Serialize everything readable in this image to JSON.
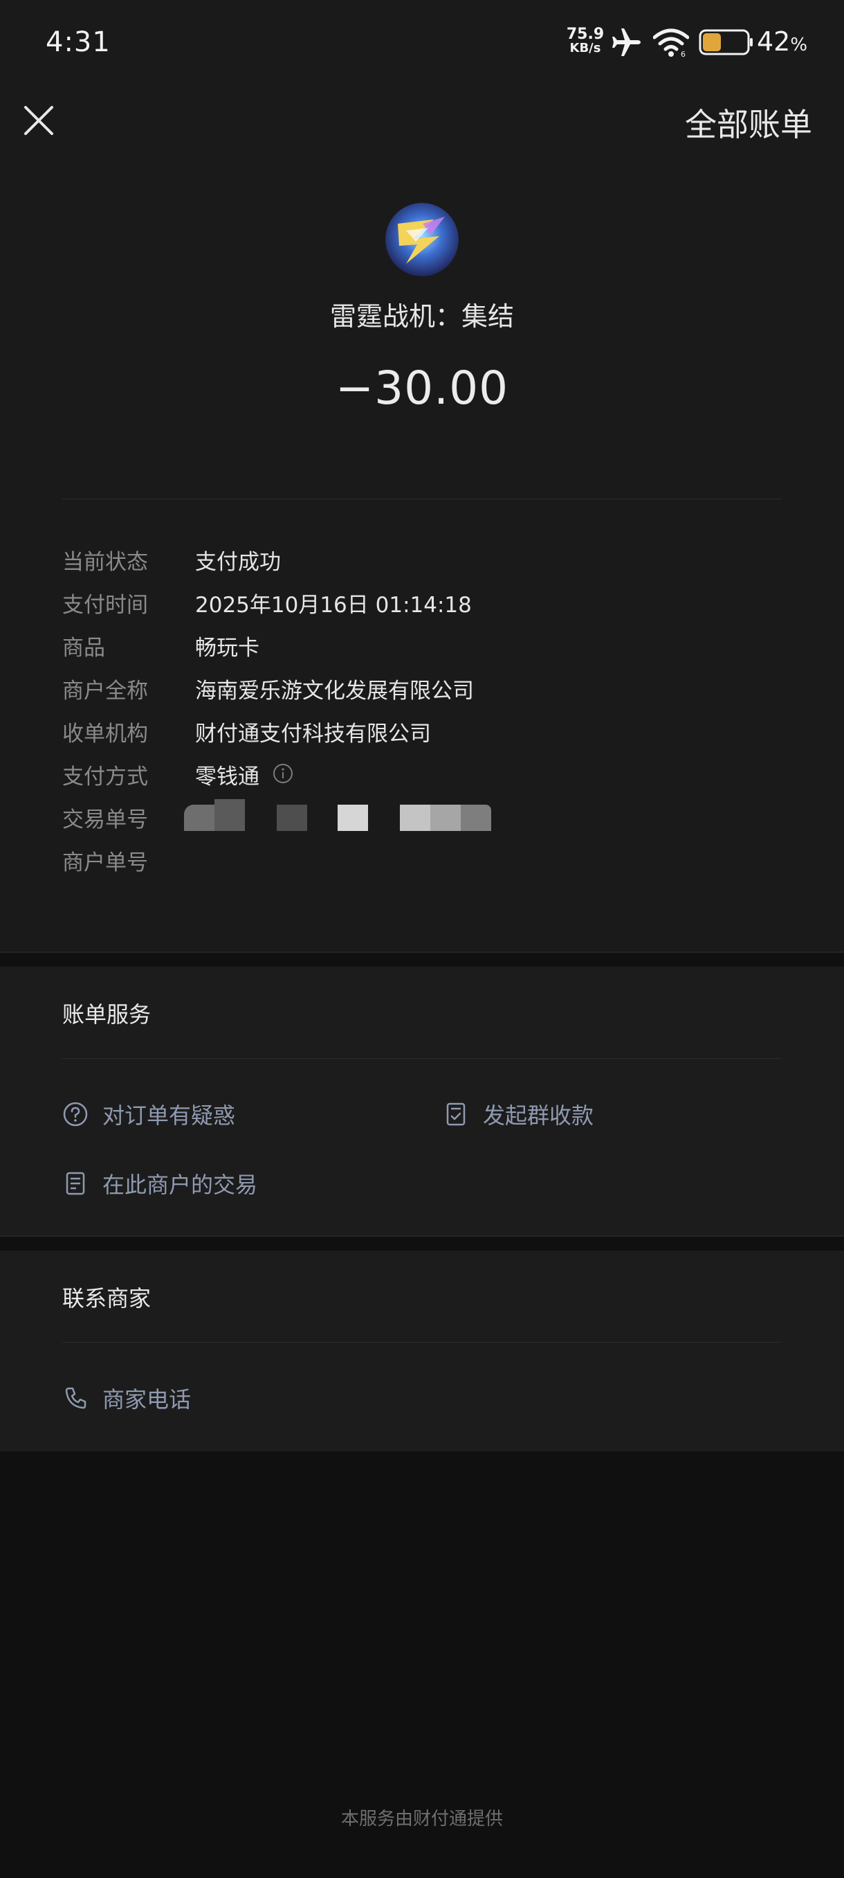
{
  "status_bar": {
    "time": "4:31",
    "net_speed_value": "75.9",
    "net_speed_unit": "KB/s",
    "battery_percent": "42",
    "battery_suffix": "%",
    "battery_level": 0.42
  },
  "header": {
    "close_icon": "close-icon",
    "all_bills_label": "全部账单"
  },
  "transaction": {
    "merchant_name": "雷霆战机：集结",
    "amount": "−30.00",
    "details": [
      {
        "label": "当前状态",
        "value": "支付成功"
      },
      {
        "label": "支付时间",
        "value": "2025年10月16日 01:14:18"
      },
      {
        "label": "商品",
        "value": "畅玩卡"
      },
      {
        "label": "商户全称",
        "value": "海南爱乐游文化发展有限公司"
      },
      {
        "label": "收单机构",
        "value": "财付通支付科技有限公司"
      },
      {
        "label": "支付方式",
        "value": "零钱通"
      },
      {
        "label": "交易单号",
        "value": ""
      },
      {
        "label": "商户单号",
        "value": ""
      }
    ]
  },
  "bill_services": {
    "title": "账单服务",
    "items": [
      {
        "label": "对订单有疑惑",
        "icon": "question-circle-icon"
      },
      {
        "label": "发起群收款",
        "icon": "document-check-icon"
      },
      {
        "label": "在此商户的交易",
        "icon": "document-list-icon"
      }
    ]
  },
  "contact_merchant": {
    "title": "联系商家",
    "items": [
      {
        "label": "商家电话",
        "icon": "phone-icon"
      }
    ]
  },
  "footer": {
    "note": "本服务由财付通提供"
  },
  "colors": {
    "page_background": "#101010",
    "panel_background": "#1a1a1a",
    "link_text": "#8f9ab0",
    "label_text": "#8a8a8a",
    "battery_fill": "#e0a63c"
  }
}
